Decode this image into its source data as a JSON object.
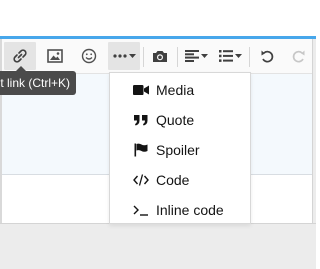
{
  "colors": {
    "accent": "#47a7eb",
    "toolbar_bg": "#fafafa",
    "editor_bg": "#f4f9fd",
    "tooltip_bg": "#4b4b4b",
    "icon": "#505050",
    "disabled_icon": "#c7c7c7"
  },
  "toolbar": {
    "buttons": [
      {
        "icon": "link-icon",
        "state": "hover"
      },
      {
        "icon": "image-icon"
      },
      {
        "icon": "smiley-icon"
      },
      {
        "icon": "more-icon",
        "state": "open"
      },
      {
        "icon": "camera-icon"
      },
      {
        "icon": "align-icon"
      },
      {
        "icon": "list-icon"
      },
      {
        "icon": "undo-icon"
      },
      {
        "icon": "redo-icon",
        "state": "disabled"
      }
    ]
  },
  "tooltip": {
    "text": "t link (Ctrl+K)"
  },
  "insert_menu": {
    "items": [
      {
        "label": "Media",
        "icon": "video-camera-icon"
      },
      {
        "label": "Quote",
        "icon": "quote-icon"
      },
      {
        "label": "Spoiler",
        "icon": "flag-icon"
      },
      {
        "label": "Code",
        "icon": "code-icon"
      },
      {
        "label": "Inline code",
        "icon": "terminal-icon"
      }
    ]
  }
}
